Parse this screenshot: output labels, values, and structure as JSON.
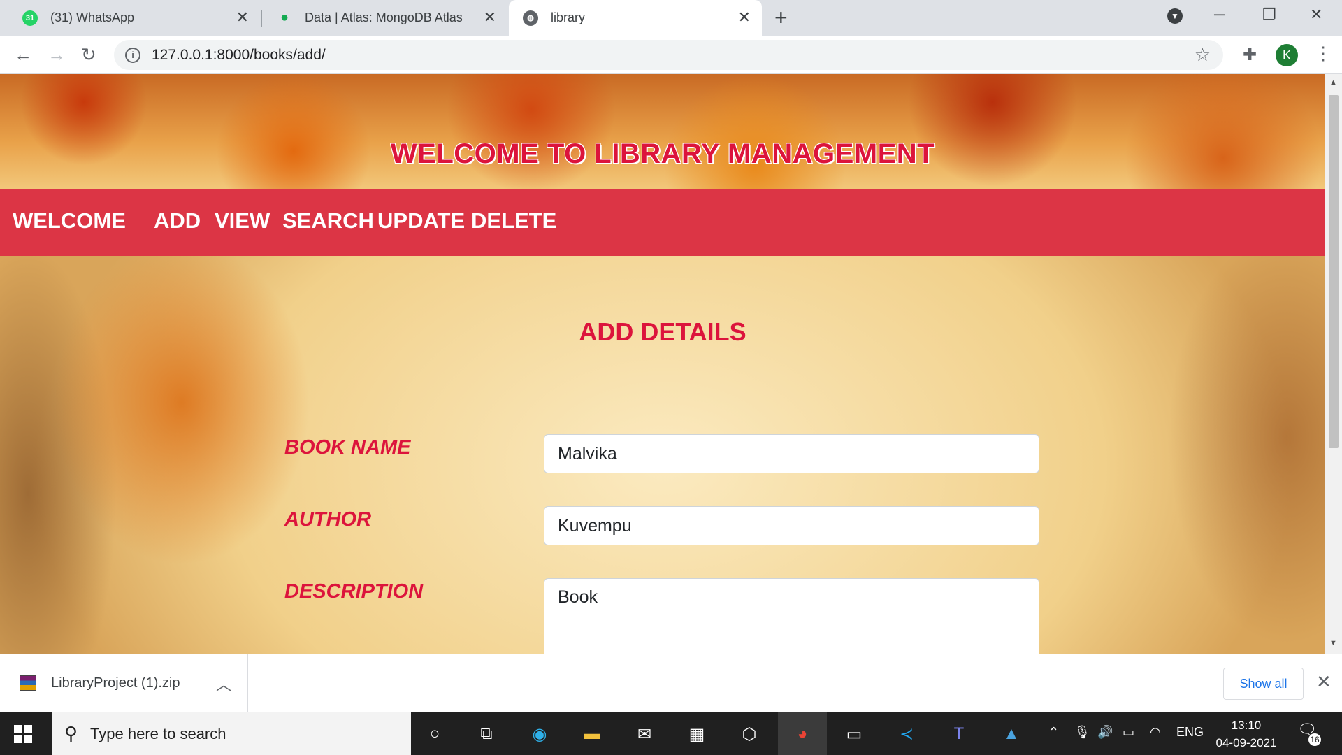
{
  "browser": {
    "tabs": [
      {
        "title": "(31) WhatsApp",
        "badge": "31"
      },
      {
        "title": "Data | Atlas: MongoDB Atlas"
      },
      {
        "title": "library"
      }
    ],
    "url": "127.0.0.1:8000/books/add/",
    "profile_initial": "K"
  },
  "page": {
    "banner_title": "WELCOME TO LIBRARY MANAGEMENT",
    "nav": {
      "brand": "WELCOME",
      "links": [
        "ADD",
        "VIEW",
        "SEARCH",
        "UPDATE",
        "DELETE"
      ]
    },
    "heading": "ADD DETAILS",
    "form": {
      "book_name_label": "BOOK NAME",
      "book_name_value": "Malvika",
      "author_label": "AUTHOR",
      "author_value": "Kuvempu",
      "description_label": "DESCRIPTION",
      "description_value": "Book"
    }
  },
  "downloads": {
    "file_name": "LibraryProject (1).zip",
    "show_all": "Show all"
  },
  "taskbar": {
    "search_placeholder": "Type here to search",
    "language": "ENG",
    "time": "13:10",
    "date": "04-09-2021",
    "notification_count": "16"
  },
  "colors": {
    "accent": "#dc143c",
    "navbar": "#dc3545"
  }
}
